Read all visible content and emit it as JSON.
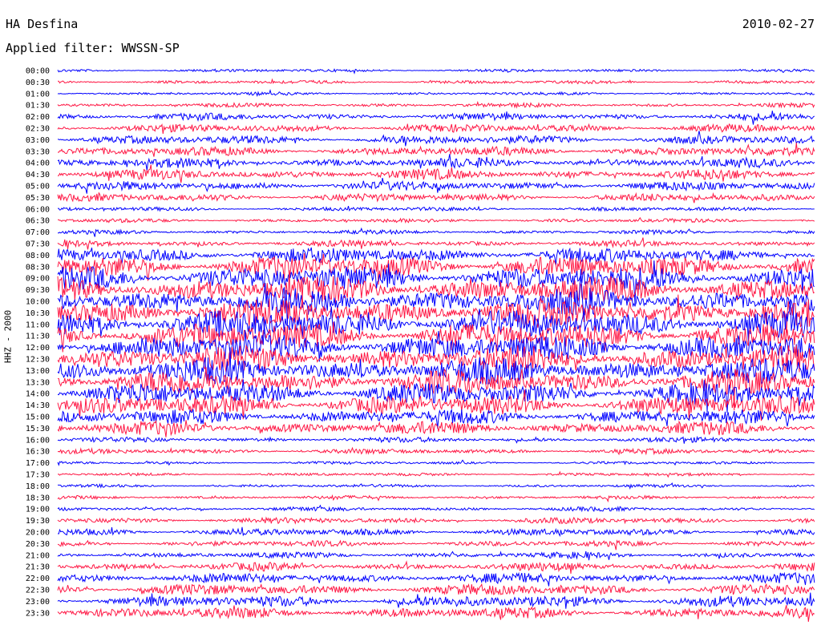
{
  "header": {
    "station": "HA Desfina",
    "date": "2010-02-27",
    "filter": "Applied filter: WWSSN-SP",
    "channel": "HHZ - 2000"
  },
  "chart_data": {
    "type": "line",
    "title": "HA Desfina",
    "ylabel": "HHZ - 2000",
    "categories": [
      "00:00",
      "00:30",
      "01:00",
      "01:30",
      "02:00",
      "02:30",
      "03:00",
      "03:30",
      "04:00",
      "04:30",
      "05:00",
      "05:30",
      "06:00",
      "06:30",
      "07:00",
      "07:30",
      "08:00",
      "08:30",
      "09:00",
      "09:30",
      "10:00",
      "10:30",
      "11:00",
      "11:30",
      "12:00",
      "12:30",
      "13:00",
      "13:30",
      "14:00",
      "14:30",
      "15:00",
      "15:30",
      "16:00",
      "16:30",
      "17:00",
      "17:30",
      "18:00",
      "18:30",
      "19:00",
      "19:30",
      "20:00",
      "20:30",
      "21:00",
      "21:30",
      "22:00",
      "22:30",
      "23:00",
      "23:30"
    ],
    "amplitude": [
      0.3,
      0.35,
      0.3,
      0.4,
      0.7,
      0.8,
      0.9,
      0.9,
      0.95,
      1.0,
      0.9,
      0.8,
      0.4,
      0.4,
      0.4,
      0.6,
      1.5,
      2.2,
      2.5,
      2.6,
      2.7,
      2.8,
      2.8,
      2.7,
      2.7,
      2.6,
      2.5,
      2.4,
      2.2,
      2.0,
      1.5,
      1.3,
      0.5,
      0.5,
      0.3,
      0.3,
      0.3,
      0.35,
      0.4,
      0.6,
      0.7,
      0.6,
      0.6,
      0.8,
      1.0,
      1.1,
      1.2,
      1.1
    ],
    "series_colors": [
      "#0000ff",
      "#ff1744"
    ],
    "grid": false,
    "legend": "none"
  }
}
